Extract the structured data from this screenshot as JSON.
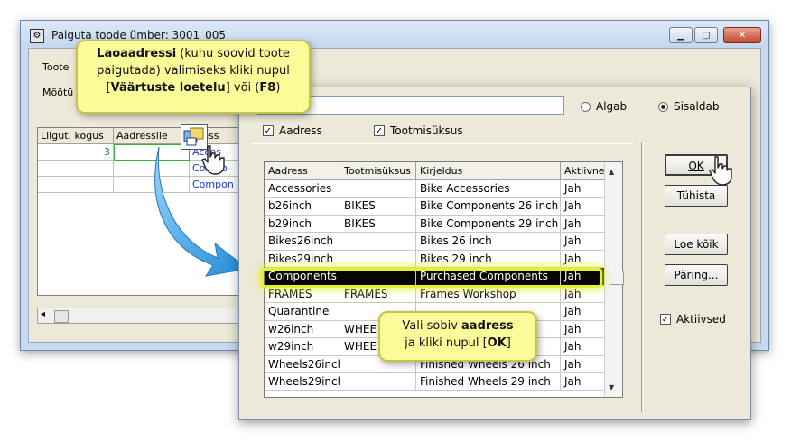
{
  "back_window": {
    "title": "Paiguta toode ümber: 3001_005",
    "label_toote": "Toote",
    "label_mootu": "Mõõtü",
    "grid_headers": [
      "Liigut. kogus",
      "Aadressile",
      "dress"
    ],
    "grid_row_qty": "3",
    "grid_cells": [
      "Acces",
      "Compo",
      "Compon"
    ],
    "scroll_left_arrow": "◂"
  },
  "dialog": {
    "search_value": "",
    "radio_algab": "Algab",
    "radio_sisaldab": "Sisaldab",
    "check_aadress": "Aadress",
    "check_tootmisuksus": "Tootmisüksus",
    "check_aktiivsed": "Aktiivsed",
    "columns": [
      "Aadress",
      "Tootmisüksus",
      "Kirjeldus",
      "Aktiivne"
    ],
    "rows": [
      [
        "Accessories",
        "",
        "Bike Accessories",
        "Jah"
      ],
      [
        "b26inch",
        "BIKES",
        "Bike Components 26 inch",
        "Jah"
      ],
      [
        "b29inch",
        "BIKES",
        "Bike Components 29 inch",
        "Jah"
      ],
      [
        "Bikes26inch",
        "",
        "Bikes 26 inch",
        "Jah"
      ],
      [
        "Bikes29inch",
        "",
        "Bikes 29 inch",
        "Jah"
      ],
      [
        "Components",
        "",
        "Purchased Components",
        "Jah"
      ],
      [
        "FRAMES",
        "FRAMES",
        "Frames Workshop",
        "Jah"
      ],
      [
        "Quarantine",
        "",
        "",
        "Jah"
      ],
      [
        "w26inch",
        "WHEE",
        "ch",
        "Jah"
      ],
      [
        "w29inch",
        "WHEE",
        "ch",
        "Jah"
      ],
      [
        "Wheels26inch",
        "",
        "Finished Wheels 26 inch",
        "Jah"
      ],
      [
        "Wheels29inch",
        "",
        "Finished Wheels 29 inch",
        "Jah"
      ]
    ],
    "buttons": {
      "ok": "OK",
      "tuhista": "Tühista",
      "loe_koik": "Loe kõik",
      "paring": "Päring..."
    }
  },
  "callout_top": {
    "bold1": "Laoaadressi",
    "text1": " (kuhu soovid toote paigutada) valimiseks kliki nupul ",
    "bracket_open": "[",
    "bold2": "Väärtuste loetelu",
    "bracket_close": "]",
    "text2": " või (",
    "bold3": "F8",
    "text3": ")"
  },
  "callout_bottom": {
    "text1": "Vali sobiv ",
    "bold1": "aadress",
    "text2": "ja kliki nupul  [",
    "bold2": "OK",
    "text3": "]"
  },
  "colors": {
    "callout_bg": "#fcfb9a",
    "highlight": "#e6f033",
    "arrow": "#3fa7e8"
  }
}
